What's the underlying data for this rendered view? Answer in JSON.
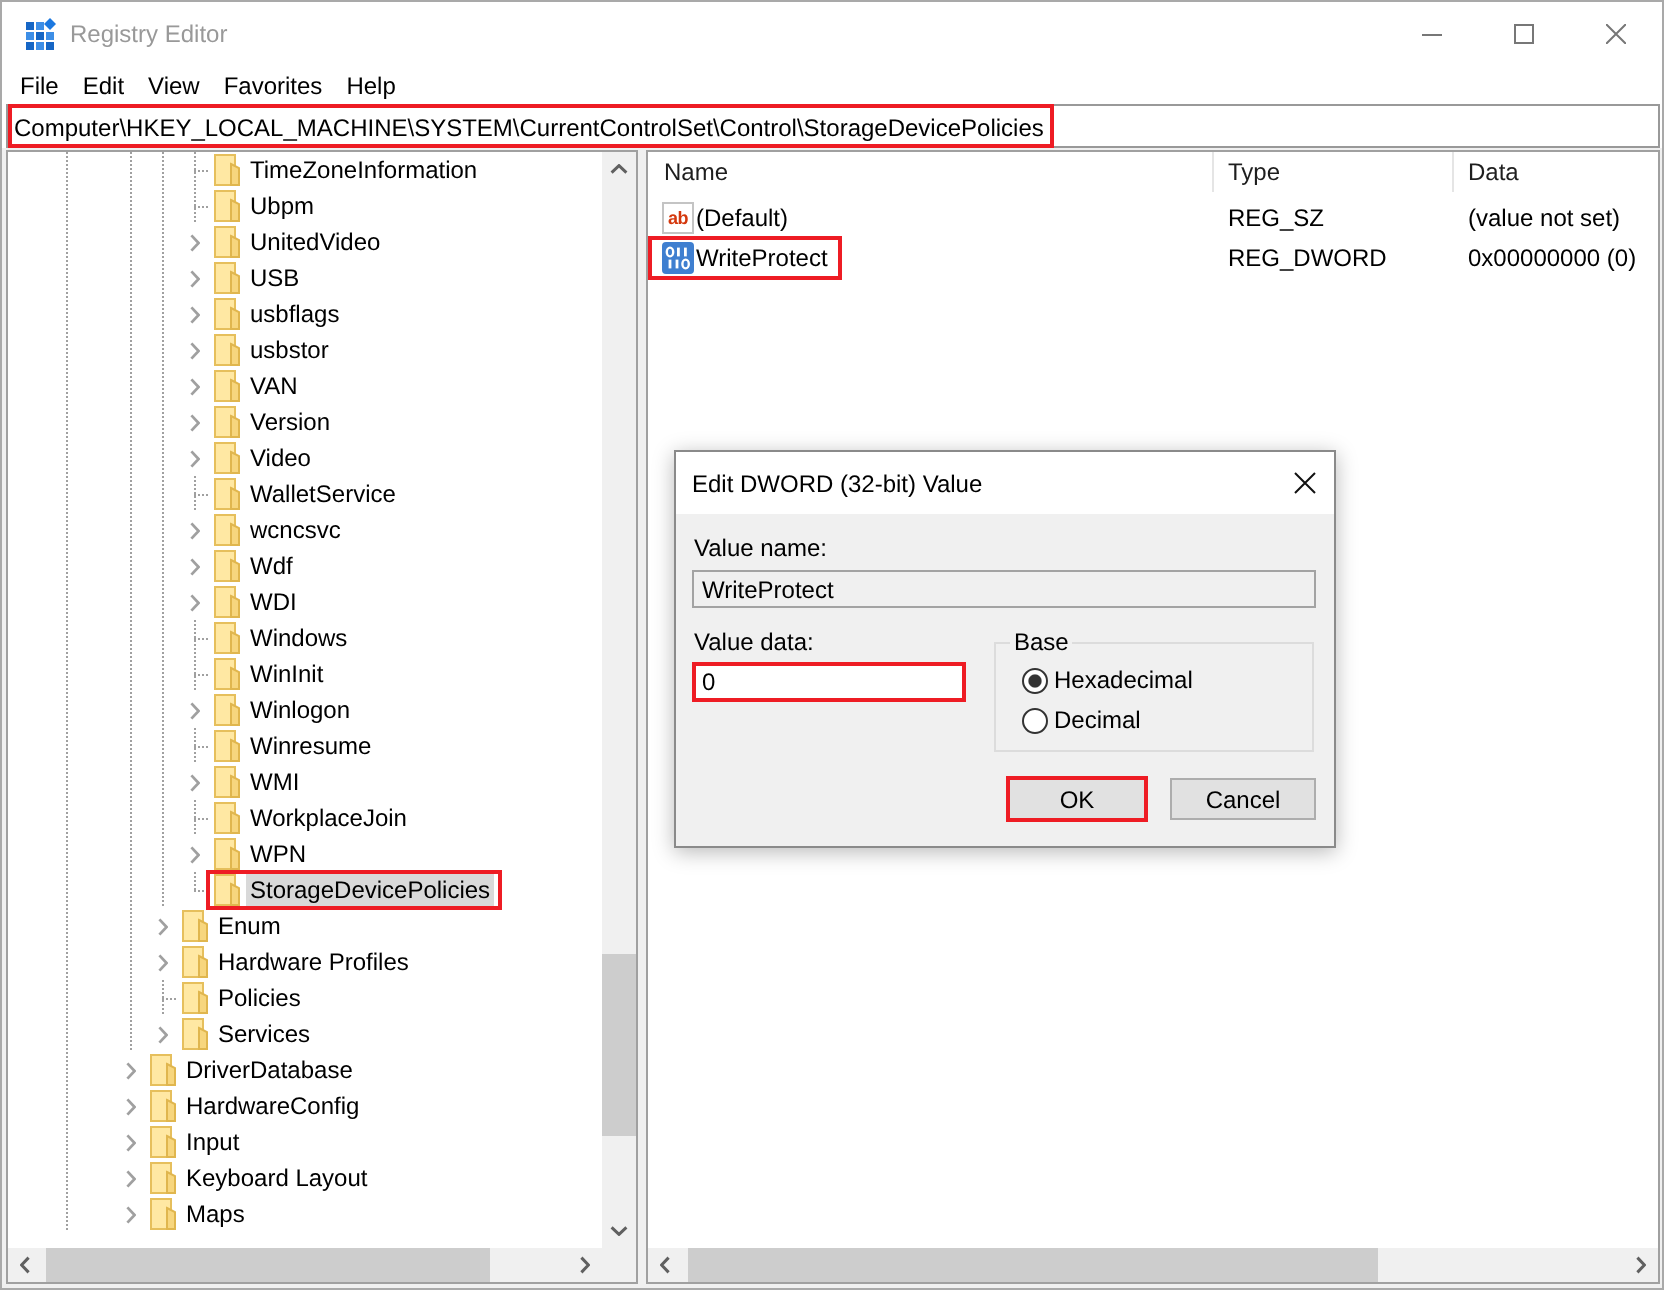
{
  "window": {
    "title": "Registry Editor"
  },
  "menu": [
    "File",
    "Edit",
    "View",
    "Favorites",
    "Help"
  ],
  "address_bar": {
    "value": "Computer\\HKEY_LOCAL_MACHINE\\SYSTEM\\CurrentControlSet\\Control\\StorageDevicePolicies",
    "highlighted": true
  },
  "tree": {
    "items": [
      {
        "children": [
          {
            "more_siblings_below": true,
            "children": [
              {
                "children": [
                  {
                    "children": [
                      {
                        "children": [
                          {
                            "label": "TimeZoneInformation",
                            "expandable": false,
                            "selected": false,
                            "highlighted": false
                          },
                          {
                            "label": "Ubpm",
                            "expandable": false,
                            "selected": false,
                            "highlighted": false
                          },
                          {
                            "label": "UnitedVideo",
                            "expandable": true,
                            "selected": false,
                            "highlighted": false
                          },
                          {
                            "label": "USB",
                            "expandable": true,
                            "selected": false,
                            "highlighted": false
                          },
                          {
                            "label": "usbflags",
                            "expandable": true,
                            "selected": false,
                            "highlighted": false
                          },
                          {
                            "label": "usbstor",
                            "expandable": true,
                            "selected": false,
                            "highlighted": false
                          },
                          {
                            "label": "VAN",
                            "expandable": true,
                            "selected": false,
                            "highlighted": false
                          },
                          {
                            "label": "Version",
                            "expandable": true,
                            "selected": false,
                            "highlighted": false
                          },
                          {
                            "label": "Video",
                            "expandable": true,
                            "selected": false,
                            "highlighted": false
                          },
                          {
                            "label": "WalletService",
                            "expandable": false,
                            "selected": false,
                            "highlighted": false
                          },
                          {
                            "label": "wcncsvc",
                            "expandable": true,
                            "selected": false,
                            "highlighted": false
                          },
                          {
                            "label": "Wdf",
                            "expandable": true,
                            "selected": false,
                            "highlighted": false
                          },
                          {
                            "label": "WDI",
                            "expandable": true,
                            "selected": false,
                            "highlighted": false
                          },
                          {
                            "label": "Windows",
                            "expandable": false,
                            "selected": false,
                            "highlighted": false
                          },
                          {
                            "label": "WinInit",
                            "expandable": false,
                            "selected": false,
                            "highlighted": false
                          },
                          {
                            "label": "Winlogon",
                            "expandable": true,
                            "selected": false,
                            "highlighted": false
                          },
                          {
                            "label": "Winresume",
                            "expandable": false,
                            "selected": false,
                            "highlighted": false
                          },
                          {
                            "label": "WMI",
                            "expandable": true,
                            "selected": false,
                            "highlighted": false
                          },
                          {
                            "label": "WorkplaceJoin",
                            "expandable": false,
                            "selected": false,
                            "highlighted": false
                          },
                          {
                            "label": "WPN",
                            "expandable": true,
                            "selected": false,
                            "highlighted": false
                          },
                          {
                            "label": "StorageDevicePolicies",
                            "expandable": false,
                            "selected": true,
                            "highlighted": true
                          }
                        ]
                      },
                      {
                        "label": "Enum",
                        "expandable": true,
                        "selected": false,
                        "highlighted": false
                      },
                      {
                        "label": "Hardware Profiles",
                        "expandable": true,
                        "selected": false,
                        "highlighted": false
                      },
                      {
                        "label": "Policies",
                        "expandable": false,
                        "selected": false,
                        "highlighted": false
                      },
                      {
                        "label": "Services",
                        "expandable": true,
                        "selected": false,
                        "highlighted": false
                      }
                    ]
                  },
                  {
                    "label": "DriverDatabase",
                    "expandable": true,
                    "selected": false,
                    "highlighted": false
                  },
                  {
                    "label": "HardwareConfig",
                    "expandable": true,
                    "selected": false,
                    "highlighted": false
                  },
                  {
                    "label": "Input",
                    "expandable": true,
                    "selected": false,
                    "highlighted": false
                  },
                  {
                    "label": "Keyboard Layout",
                    "expandable": true,
                    "selected": false,
                    "highlighted": false
                  },
                  {
                    "label": "Maps",
                    "expandable": true,
                    "selected": false,
                    "highlighted": false
                  }
                ]
              }
            ]
          }
        ]
      }
    ]
  },
  "values": {
    "columns": [
      "Name",
      "Type",
      "Data"
    ],
    "rows": [
      {
        "kind": "string",
        "icon_text": "ab",
        "name": "(Default)",
        "type": "REG_SZ",
        "data": "(value not set)",
        "selected": false,
        "highlighted": false
      },
      {
        "kind": "dword",
        "name": "WriteProtect",
        "type": "REG_DWORD",
        "data": "0x00000000 (0)",
        "selected": false,
        "highlighted": true
      }
    ]
  },
  "dialog": {
    "title": "Edit DWORD (32-bit) Value",
    "value_name": {
      "label": "Value name:",
      "value": "WriteProtect"
    },
    "value_data": {
      "label": "Value data:",
      "value": "0",
      "highlighted": true
    },
    "base": {
      "label": "Base",
      "options": [
        {
          "label": "Hexadecimal",
          "selected": true
        },
        {
          "label": "Decimal",
          "selected": false
        }
      ]
    },
    "buttons": [
      {
        "label": "OK",
        "highlighted": true
      },
      {
        "label": "Cancel",
        "highlighted": false
      }
    ]
  }
}
